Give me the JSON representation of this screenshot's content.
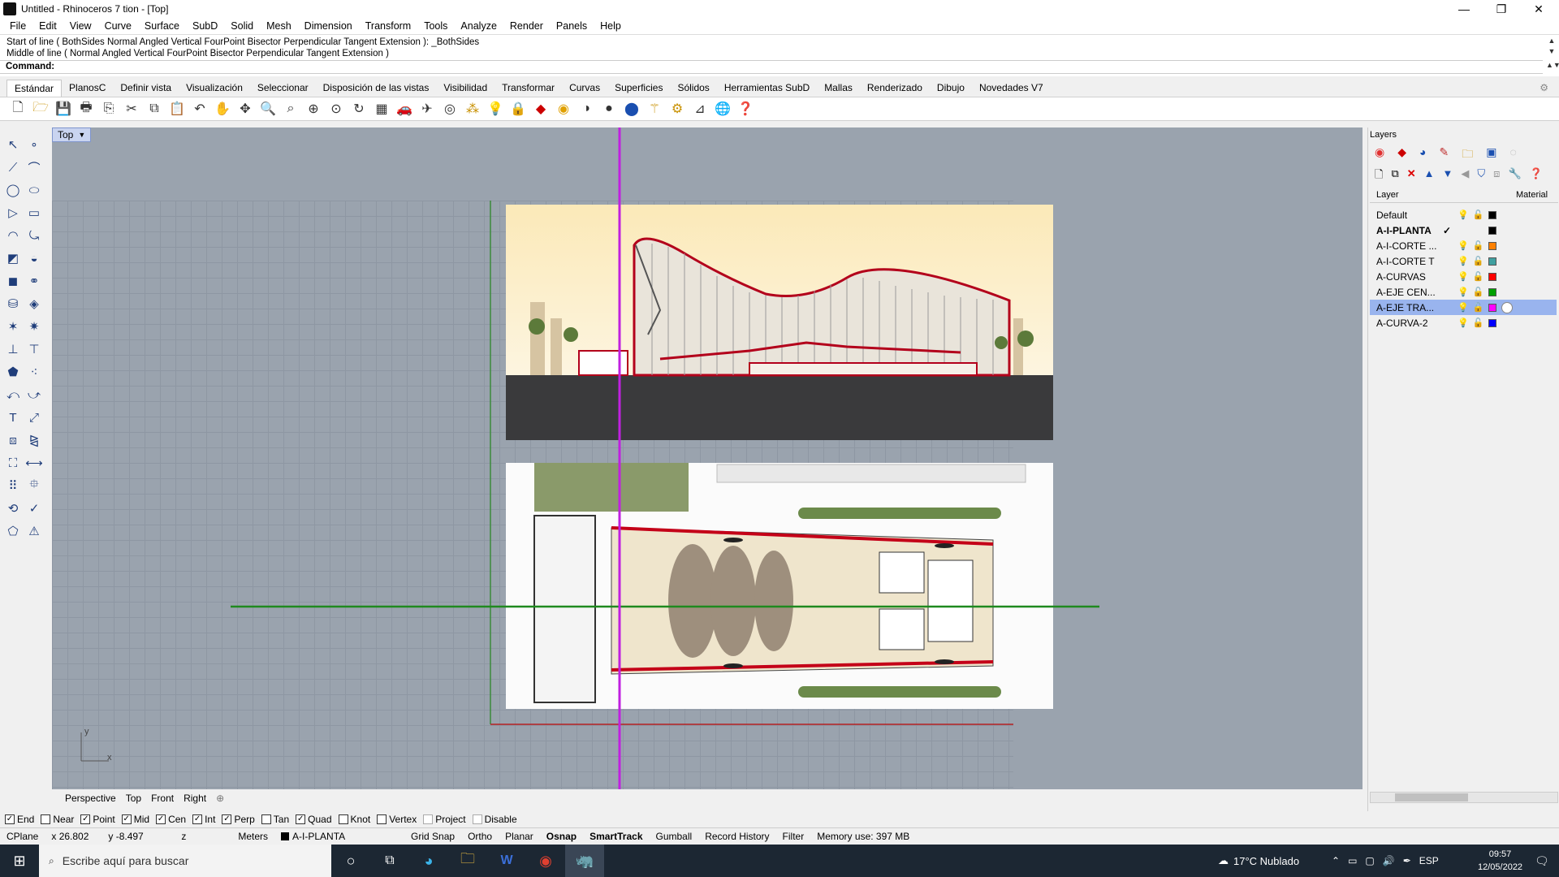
{
  "window": {
    "title": "Untitled - Rhinoceros 7 tion - [Top]",
    "min": "—",
    "max": "❐",
    "close": "✕"
  },
  "menu": [
    "File",
    "Edit",
    "View",
    "Curve",
    "Surface",
    "SubD",
    "Solid",
    "Mesh",
    "Dimension",
    "Transform",
    "Tools",
    "Analyze",
    "Render",
    "Panels",
    "Help"
  ],
  "command": {
    "history1": "Start of line ( BothSides  Normal  Angled  Vertical  FourPoint  Bisector  Perpendicular  Tangent  Extension ): _BothSides",
    "history2": "Middle of line ( Normal  Angled  Vertical  FourPoint  Bisector  Perpendicular  Tangent  Extension )",
    "prompt": "Command:"
  },
  "tabs": [
    "Estándar",
    "PlanosC",
    "Definir vista",
    "Visualización",
    "Seleccionar",
    "Disposición de las vistas",
    "Visibilidad",
    "Transformar",
    "Curvas",
    "Superficies",
    "Sólidos",
    "Herramientas SubD",
    "Mallas",
    "Renderizado",
    "Dibujo",
    "Novedades V7"
  ],
  "toolbar_icons": [
    "new-icon",
    "open-icon",
    "save-icon",
    "print-icon",
    "import-icon",
    "cut-icon",
    "copy-icon",
    "paste-icon",
    "undo-icon",
    "pan-icon",
    "rotate-icon",
    "zoom-icon",
    "zoom-window-icon",
    "zoom-extents-icon",
    "zoom-selected-icon",
    "zoom-dynamic-icon",
    "viewport-layout-icon",
    "car-icon",
    "helicopter-icon",
    "target-icon",
    "points-icon",
    "bulb-icon",
    "lock-icon",
    "layer-icon",
    "color-wheel-icon",
    "shade-icon",
    "render-icon",
    "sphere-icon",
    "wand-icon",
    "options-icon",
    "dimension-icon",
    "globe-icon",
    "help-icon"
  ],
  "viewport": {
    "name": "Top",
    "axis_y": "y",
    "axis_x": "x"
  },
  "viewport_tabs": [
    "Perspective",
    "Top",
    "Front",
    "Right"
  ],
  "osnaps": [
    {
      "label": "End",
      "checked": true
    },
    {
      "label": "Near",
      "checked": false
    },
    {
      "label": "Point",
      "checked": true
    },
    {
      "label": "Mid",
      "checked": true
    },
    {
      "label": "Cen",
      "checked": true
    },
    {
      "label": "Int",
      "checked": true
    },
    {
      "label": "Perp",
      "checked": true
    },
    {
      "label": "Tan",
      "checked": false
    },
    {
      "label": "Quad",
      "checked": true
    },
    {
      "label": "Knot",
      "checked": false
    },
    {
      "label": "Vertex",
      "checked": false
    },
    {
      "label": "Project",
      "checked": false
    },
    {
      "label": "Disable",
      "checked": false
    }
  ],
  "status": {
    "cplane": "CPlane",
    "x": "x 26.802",
    "y": "y -8.497",
    "z": "z",
    "units": "Meters",
    "layer": "A-I-PLANTA",
    "grid_snap": "Grid Snap",
    "ortho": "Ortho",
    "planar": "Planar",
    "osnap": "Osnap",
    "smarttrack": "SmartTrack",
    "gumball": "Gumball",
    "record_history": "Record History",
    "filter": "Filter",
    "memory": "Memory use: 397 MB"
  },
  "layers_panel": {
    "title": "Layers",
    "col_layer": "Layer",
    "col_material": "Material",
    "rows": [
      {
        "name": "Default",
        "color": "#000000",
        "current": false,
        "selected": false
      },
      {
        "name": "A-I-PLANTA",
        "color": "#000000",
        "current": true,
        "selected": false
      },
      {
        "name": "A-I-CORTE ...",
        "color": "#ff8000",
        "current": false,
        "selected": false
      },
      {
        "name": "A-I-CORTE T",
        "color": "#40a0a0",
        "current": false,
        "selected": false
      },
      {
        "name": "A-CURVAS",
        "color": "#ff0000",
        "current": false,
        "selected": false
      },
      {
        "name": "A-EJE CEN...",
        "color": "#00a000",
        "current": false,
        "selected": false
      },
      {
        "name": "A-EJE TRA...",
        "color": "#ff00ff",
        "current": false,
        "selected": true
      },
      {
        "name": "A-CURVA-2",
        "color": "#0000ff",
        "current": false,
        "selected": false
      }
    ]
  },
  "taskbar": {
    "search": "Escribe aquí para buscar",
    "weather": "17°C  Nublado",
    "lang": "ESP",
    "time": "09:57",
    "date": "12/05/2022"
  }
}
